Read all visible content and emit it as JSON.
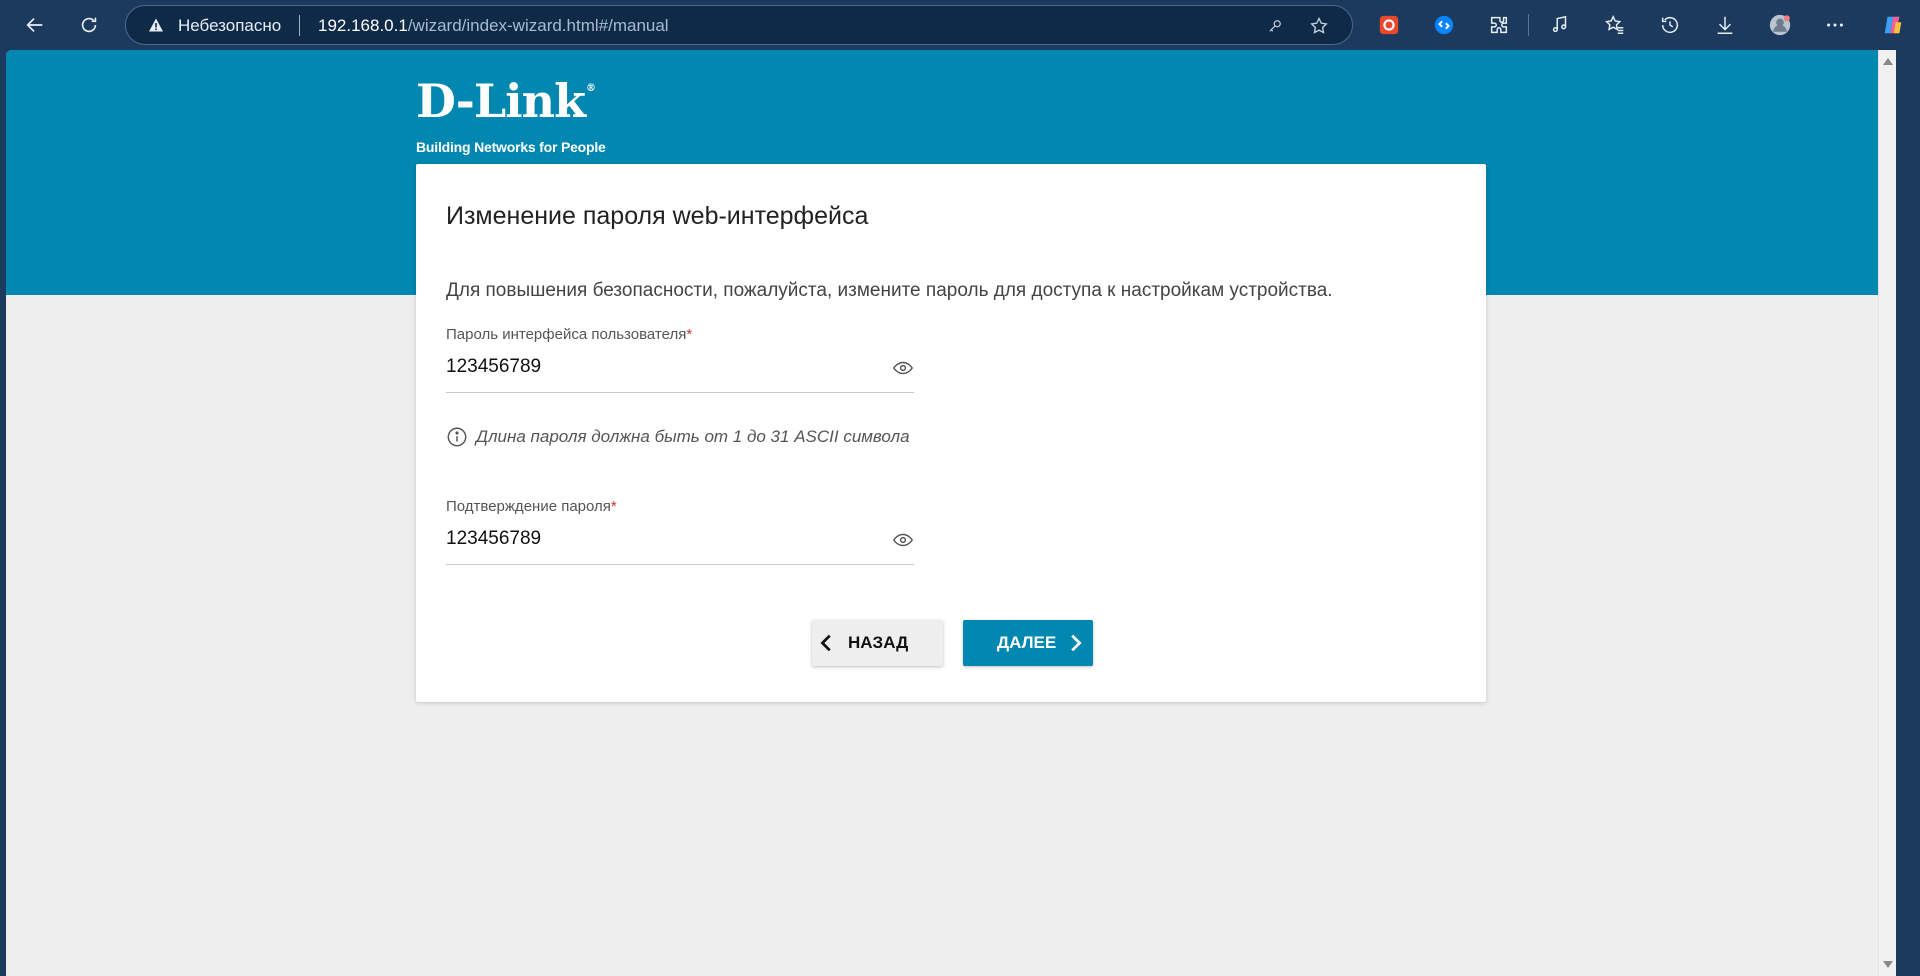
{
  "browser": {
    "insecure_label": "Небезопасно",
    "url_host": "192.168.0.1",
    "url_path": "/wizard/index-wizard.html#/manual",
    "icons": [
      "back-icon",
      "reload-icon",
      "warning-icon",
      "key-icon",
      "star-icon",
      "extension-red-icon",
      "shazam-icon",
      "puzzle-icon",
      "media-icon",
      "favorites-icon",
      "history-icon",
      "download-icon",
      "profile-icon",
      "more-icon",
      "copilot-icon"
    ]
  },
  "logo": {
    "brand": "D-Link",
    "registered": "®",
    "tagline": "Building Networks for People"
  },
  "card": {
    "title": "Изменение пароля web-интерфейса",
    "description": "Для повышения безопасности, пожалуйста, измените пароль для доступа к настройкам устройства.",
    "password_field": {
      "label": "Пароль интерфейса пользователя",
      "required_mark": "*",
      "value": "123456789"
    },
    "hint": "Длина пароля должна быть от 1 до 31 ASCII символа",
    "confirm_field": {
      "label": "Подтверждение пароля",
      "required_mark": "*",
      "value": "123456789"
    },
    "back_button": "НАЗАД",
    "next_button": "ДАЛЕЕ"
  },
  "colors": {
    "accent": "#0187b0",
    "browser_frame": "#1c3a5e",
    "page_background": "#eeeeee"
  }
}
